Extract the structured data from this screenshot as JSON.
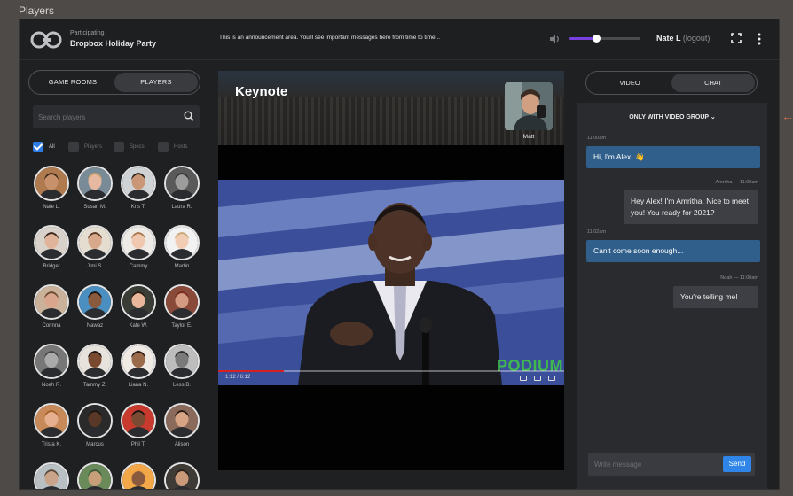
{
  "window_label": "Players",
  "header": {
    "logo_icon": "infinity-logo-icon",
    "event_status": "Participating",
    "event_name": "Dropbox Holiday Party",
    "announcement": "This is an announcement area. You'll see important messages here from time to time...",
    "volume_level": 0.38,
    "user_name": "Nate L",
    "logout_label": "(logout)"
  },
  "left_panel": {
    "tabs": [
      {
        "label": "GAME ROOMS",
        "active": false
      },
      {
        "label": "PLAYERS",
        "active": true
      }
    ],
    "search_placeholder": "Search players",
    "filters": [
      {
        "label": "All",
        "checked": true
      },
      {
        "label": "Players",
        "checked": false
      },
      {
        "label": "Specs",
        "checked": false
      },
      {
        "label": "Hosts",
        "checked": false
      }
    ],
    "players": [
      {
        "name": "Nate L.",
        "skin": "#c7916b",
        "hair": "#3a2a1e",
        "bg": "#b07a4f"
      },
      {
        "name": "Susan M.",
        "skin": "#e7b9a0",
        "hair": "#c9a06a",
        "bg": "#7a8b98"
      },
      {
        "name": "Kris T.",
        "skin": "#c99778",
        "hair": "#2a211c",
        "bg": "#cfd3d6"
      },
      {
        "name": "Laura R.",
        "skin": "#9c9c9c",
        "hair": "#333333",
        "bg": "#5a5a5a"
      },
      {
        "name": "Bridget",
        "skin": "#e0b49a",
        "hair": "#3a2418",
        "bg": "#d9d2cb"
      },
      {
        "name": "Jimi S.",
        "skin": "#d8a88a",
        "hair": "#5a3a22",
        "bg": "#e5ddd0"
      },
      {
        "name": "Cammy",
        "skin": "#f0c8b0",
        "hair": "#a8774a",
        "bg": "#eeeae6"
      },
      {
        "name": "Martin",
        "skin": "#f1cdb6",
        "hair": "#c9a676",
        "bg": "#f2f2f2"
      },
      {
        "name": "Corinna",
        "skin": "#d9a58c",
        "hair": "#6b4a30",
        "bg": "#c9b19a"
      },
      {
        "name": "Nawaz",
        "skin": "#8a5a3e",
        "hair": "#1c1410",
        "bg": "#4a8fc0"
      },
      {
        "name": "Kate W.",
        "skin": "#e8b69a",
        "hair": "#2a1c14",
        "bg": "#3a3d36"
      },
      {
        "name": "Taylor E.",
        "skin": "#d49a82",
        "hair": "#7a2a1e",
        "bg": "#8a4a3a"
      },
      {
        "name": "Noah R.",
        "skin": "#aaaaaa",
        "hair": "#444444",
        "bg": "#777777"
      },
      {
        "name": "Tammy Z.",
        "skin": "#7a4a30",
        "hair": "#1c1410",
        "bg": "#e7e2dc"
      },
      {
        "name": "Liana N.",
        "skin": "#9a6a4a",
        "hair": "#2a1a12",
        "bg": "#efeae4"
      },
      {
        "name": "Less B.",
        "skin": "#7a7a7a",
        "hair": "#2c2c2c",
        "bg": "#bdbdbd"
      },
      {
        "name": "Trista K.",
        "skin": "#e6b090",
        "hair": "#a8602a",
        "bg": "#c98a5a"
      },
      {
        "name": "Marcus",
        "skin": "#5a3828",
        "hair": "#1c1410",
        "bg": "#2a2a2a"
      },
      {
        "name": "Phil T.",
        "skin": "#7a4a32",
        "hair": "#1a1210",
        "bg": "#c83a2e"
      },
      {
        "name": "Alison",
        "skin": "#d7a486",
        "hair": "#2a1c14",
        "bg": "#8a6a5a"
      },
      {
        "name": "",
        "skin": "#c9a48a",
        "hair": "#5a4a3a",
        "bg": "#b8c0c4"
      },
      {
        "name": "",
        "skin": "#c7a07a",
        "hair": "#3a5a3a",
        "bg": "#6a8a5a"
      },
      {
        "name": "",
        "skin": "#8a5a3e",
        "hair": "#f0a040",
        "bg": "#f2a848"
      },
      {
        "name": "",
        "skin": "#c89a7a",
        "hair": "#2a1e16",
        "bg": "#3e3a36"
      }
    ]
  },
  "stage": {
    "title": "Keynote",
    "pip_name": "Matt",
    "video_time": "1:12 / 6:12",
    "video_progress": 0.19,
    "watermark": "PODIUM"
  },
  "right_panel": {
    "tabs": [
      {
        "label": "VIDEO",
        "active": false
      },
      {
        "label": "CHAT",
        "active": true
      }
    ],
    "channel_label": "ONLY WITH VIDEO GROUP",
    "messages": [
      {
        "meta": "11:00am",
        "text": "Hi, I'm Alex! 👋",
        "direction": "in"
      },
      {
        "meta": "Amritha — 11:00am",
        "text": "Hey Alex! I'm Amritha. Nice to meet you! You ready for 2021?",
        "direction": "out"
      },
      {
        "meta": "11:02am",
        "text": "Can't come soon enough...",
        "direction": "in"
      },
      {
        "meta": "Noah — 11:00am",
        "text": "You're telling me!",
        "direction": "out"
      }
    ],
    "compose_placeholder": "Write message",
    "send_label": "Send"
  },
  "colors": {
    "accent": "#7a3fe0",
    "send_button": "#2f86e8",
    "incoming_bubble": "#2f5f8a",
    "outgoing_bubble": "#3e3f44",
    "checkbox_on": "#2f7be6"
  }
}
